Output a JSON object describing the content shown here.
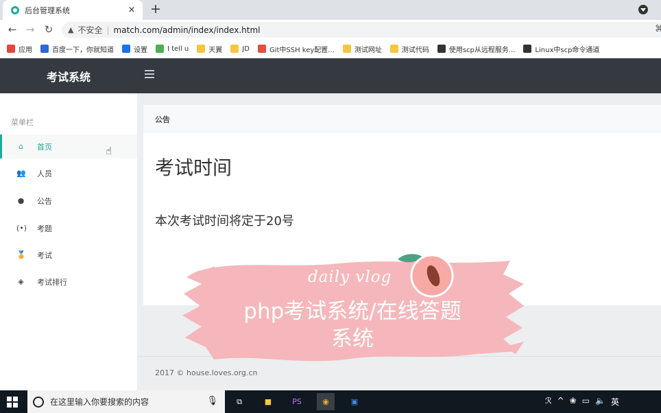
{
  "browser": {
    "tab_title": "后台管理系统",
    "tab_close": "×",
    "new_tab": "+",
    "insecure_label": "不安全",
    "separator": "|",
    "url": "match.com/admin/index/index.html",
    "bookmarks": [
      {
        "label": "应用",
        "color": "#e8453c"
      },
      {
        "label": "百度一下，你就知道",
        "color": "#2f66d8"
      },
      {
        "label": "设置",
        "color": "#1a73e8"
      },
      {
        "label": "I tell u",
        "color": "#4caf50"
      },
      {
        "label": "天翼",
        "color": "#f6c544"
      },
      {
        "label": "JD",
        "color": "#f6c544"
      },
      {
        "label": "Git中SSH key配置...",
        "color": "#e04f3f"
      },
      {
        "label": "测试网址",
        "color": "#f6c544"
      },
      {
        "label": "测试代码",
        "color": "#f6c544"
      },
      {
        "label": "使用scp从远程服务...",
        "color": "#333333"
      },
      {
        "label": "Linux中scp命令通道",
        "color": "#333333"
      }
    ]
  },
  "app": {
    "brand": "考试系统",
    "accent_color": "#20a99a",
    "sidebar": {
      "heading": "菜单栏",
      "items": [
        {
          "label": "首页",
          "icon": "home-icon",
          "glyph": "⌂",
          "active": true
        },
        {
          "label": "人员",
          "icon": "users-icon",
          "glyph": "👥",
          "active": false
        },
        {
          "label": "公告",
          "icon": "circle-icon",
          "glyph": "●",
          "active": false
        },
        {
          "label": "考题",
          "icon": "broadcast-icon",
          "glyph": "(•)",
          "active": false
        },
        {
          "label": "考试",
          "icon": "medal-icon",
          "glyph": "🏅",
          "active": false
        },
        {
          "label": "考试排行",
          "icon": "layers-icon",
          "glyph": "◈",
          "active": false
        }
      ]
    },
    "card": {
      "header": "公告",
      "title": "考试时间",
      "body": "本次考试时间将定于20号"
    },
    "footer": "2017 © house.loves.org.cn"
  },
  "overlay": {
    "vlog": "daily vlog",
    "title_line1": "php考试系统/在线答题",
    "title_line2": "系统"
  },
  "taskbar": {
    "search_placeholder": "在这里输入你要搜索的内容",
    "ime": "英"
  }
}
